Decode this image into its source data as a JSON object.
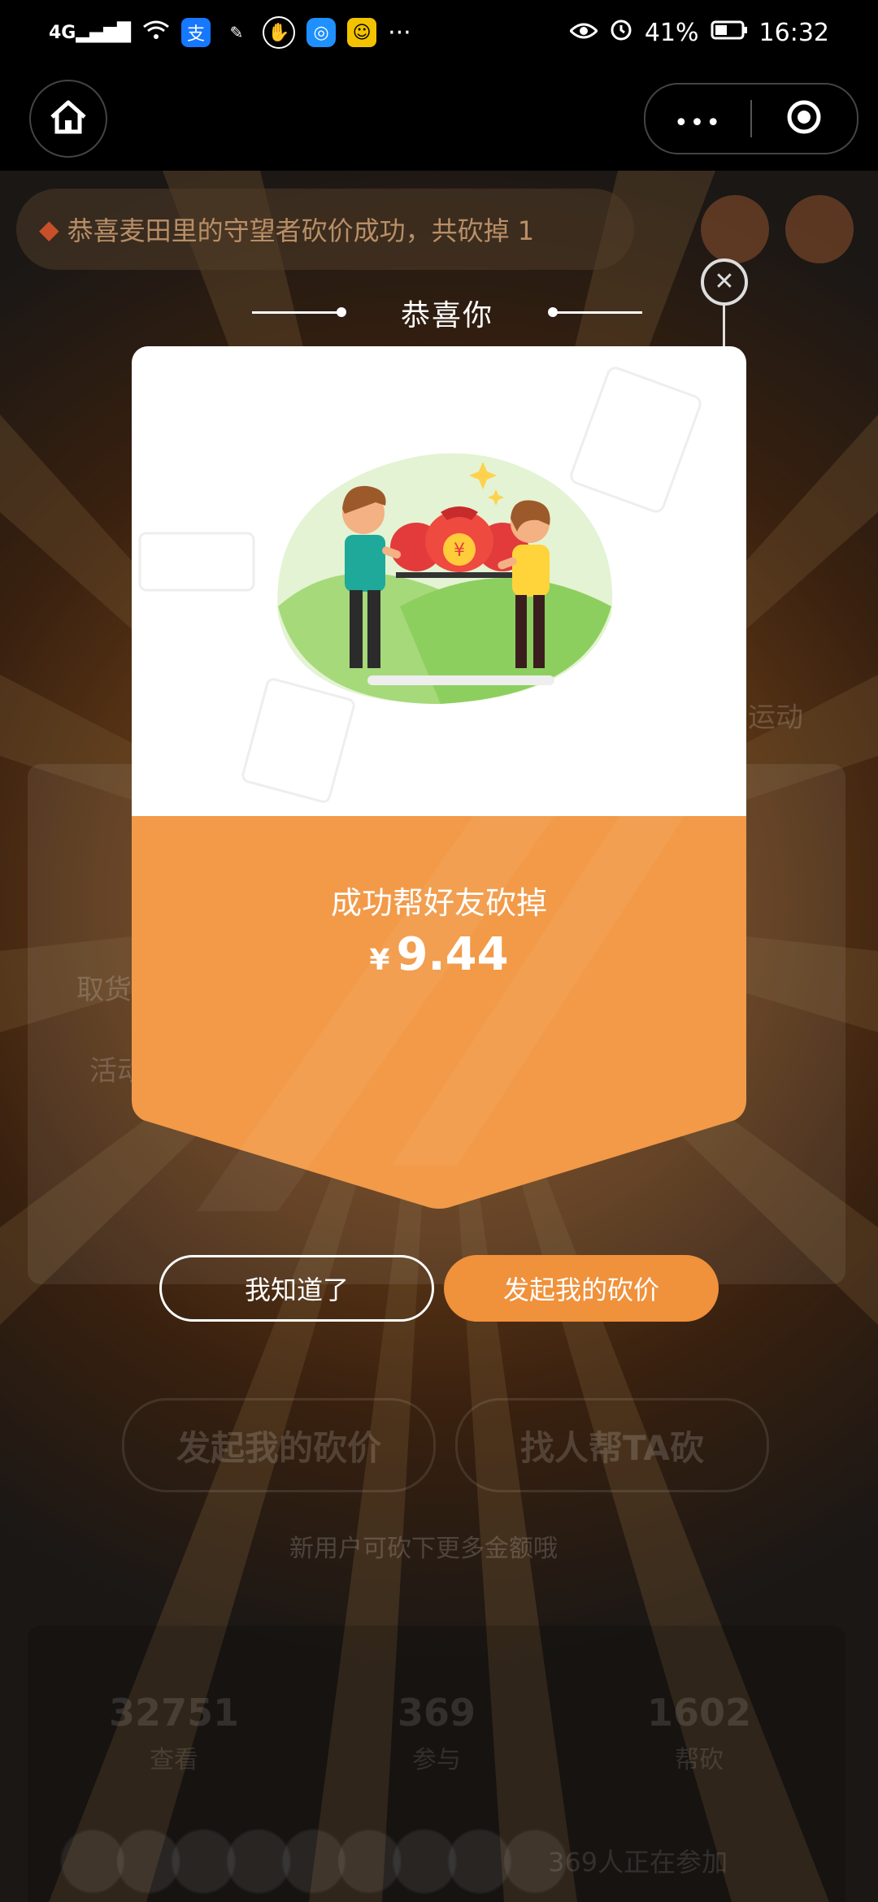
{
  "status_bar": {
    "network": "4G",
    "battery": "41%",
    "time": "16:32",
    "more": "···",
    "icons": [
      "signal-icon",
      "wifi-icon",
      "alipay-icon",
      "app-icon",
      "hand-icon",
      "browser-icon",
      "emoji-icon",
      "eye-icon",
      "alarm-icon",
      "battery-icon"
    ]
  },
  "nav": {
    "home_icon": "home-icon",
    "more_icon": "more-dots-icon",
    "target_icon": "target-icon",
    "more_glyph": "•••"
  },
  "background": {
    "notice": "恭喜麦田里的守望者砍价成功，共砍掉 1",
    "left_text_1": "取货",
    "left_text_2": "活动",
    "right_text": "运动",
    "btn_start": "发起我的砍价",
    "btn_help": "找人帮TA砍",
    "new_user_tip": "新用户可砍下更多金额哦",
    "stats": [
      {
        "num": "32751",
        "label": "查看"
      },
      {
        "num": "369",
        "label": "参与"
      },
      {
        "num": "1602",
        "label": "帮砍"
      }
    ],
    "join_text": "369人正在参加"
  },
  "modal": {
    "title": "恭喜你",
    "close_glyph": "✕",
    "result_label": "成功帮好友砍掉",
    "currency": "¥",
    "amount": "9.44",
    "btn_ok": "我知道了",
    "btn_start": "发起我的砍价",
    "colors": {
      "accent": "#f0913b",
      "card_orange": "#f29a48"
    }
  }
}
